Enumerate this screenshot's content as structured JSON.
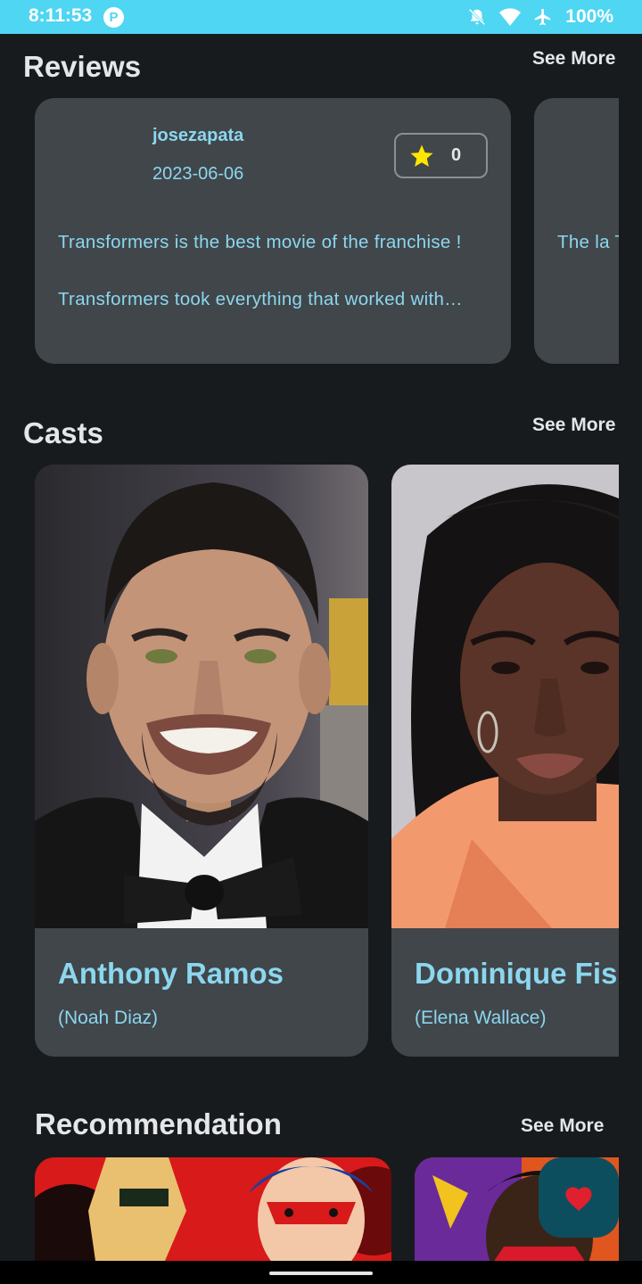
{
  "status_bar": {
    "time": "8:11:53",
    "app_icon_letter": "P",
    "battery": "100%"
  },
  "reviews": {
    "title": "Reviews",
    "see_more": "See More",
    "items": [
      {
        "author": "josezapata",
        "date": "2023-06-06",
        "rating": "0",
        "paragraph1": "Transformers is the best movie of the franchise !",
        "paragraph2": "Transformers took everything that worked with…"
      },
      {
        "text": "The la Transfo “Transf cuefro"
      }
    ]
  },
  "casts": {
    "title": "Casts",
    "see_more": "See More",
    "items": [
      {
        "name": "Anthony Ramos",
        "role": "(Noah Diaz)"
      },
      {
        "name": "Dominique Fishback",
        "role": "(Elena Wallace)"
      }
    ]
  },
  "recommendation": {
    "title": "Recommendation",
    "see_more": "See More"
  },
  "colors": {
    "accent": "#8bd7ef",
    "card": "#41464a",
    "background": "#181b1e",
    "status_bar": "#4fd6f2",
    "fab": "#0c4e5e",
    "heart": "#e0202e",
    "star": "#ffe500"
  },
  "icons": {
    "fab": "heart-icon",
    "rating": "star-icon"
  }
}
